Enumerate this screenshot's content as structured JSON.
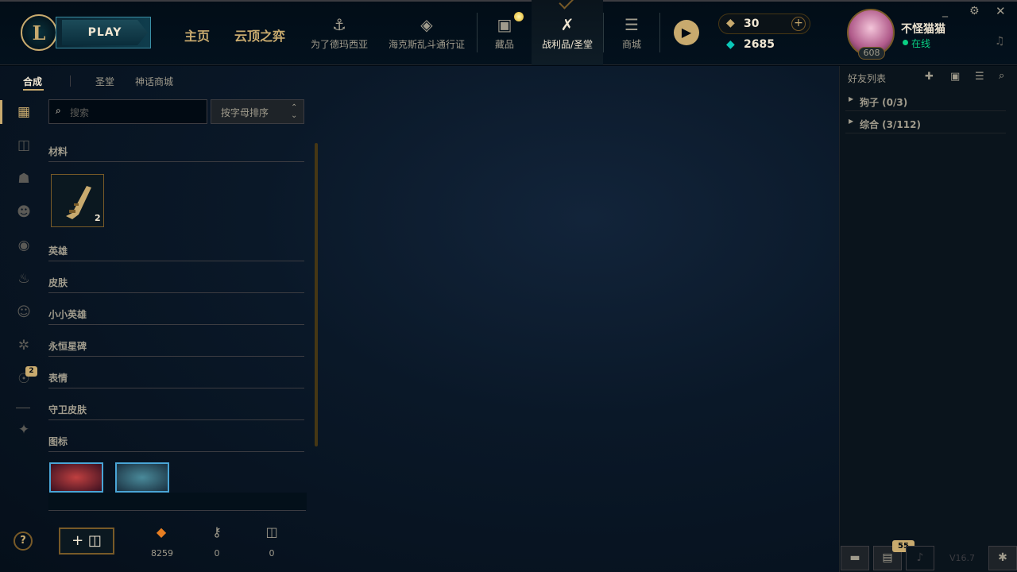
{
  "topbar": {
    "logo_letter": "L",
    "play_label": "PLAY",
    "nav_home": "主页",
    "nav_tft": "云顶之弈",
    "nav_items": [
      {
        "label": "为了德玛西亚",
        "icon": "trident-icon"
      },
      {
        "label": "海克斯乱斗通行证",
        "icon": "dice-icon"
      },
      {
        "label": "藏品",
        "icon": "collection-bag-icon"
      },
      {
        "label": "战利品/圣堂",
        "icon": "loot-icon"
      },
      {
        "label": "商城",
        "icon": "coins-icon"
      }
    ],
    "rp_amount": "30",
    "be_amount": "2685",
    "rp_add": "+",
    "user_name": "不怪猫猫",
    "user_status": "在线",
    "user_level": "608"
  },
  "left": {
    "tabs": [
      "合成",
      "圣堂",
      "神话商城"
    ],
    "search_placeholder": "搜索",
    "sort_label": "按字母排序",
    "categories": [
      "材料",
      "英雄",
      "皮肤",
      "小小英雄",
      "永恒星碑",
      "表情",
      "守卫皮肤",
      "图标"
    ],
    "material_count": "2",
    "side_badge": "2",
    "help": "?",
    "add_chest": "+",
    "counters": [
      {
        "value": "8259",
        "icon": "orange-essence-icon"
      },
      {
        "value": "0",
        "icon": "key-fragment-icon"
      },
      {
        "value": "0",
        "icon": "chest-icon"
      }
    ]
  },
  "friends": {
    "title": "好友列表",
    "groups": [
      "狗子 (0/3)",
      "综合 (3/112)"
    ],
    "badge": "55",
    "version": "V16.7"
  },
  "colors": {
    "gold": "#c8aa6e",
    "teal": "#0ac8b9",
    "online": "#0acf83"
  }
}
